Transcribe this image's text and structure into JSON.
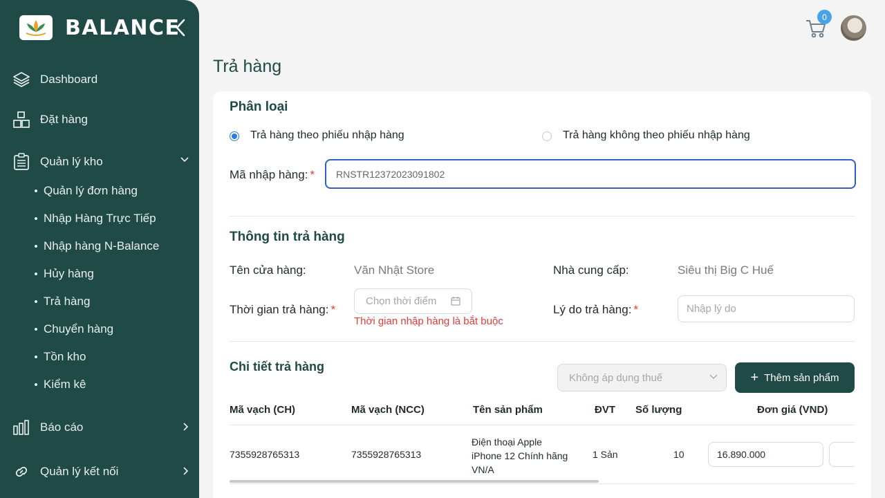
{
  "brand": {
    "name": "BALANCE",
    "logo_icon": "lotus-logo-icon"
  },
  "sidebar": {
    "items": [
      {
        "label": "Dashboard",
        "icon": "layers-icon"
      },
      {
        "label": "Đặt hàng",
        "icon": "boxes-icon"
      },
      {
        "label": "Quản lý kho",
        "icon": "clipboard-icon",
        "expanded": true
      },
      {
        "label": "Báo cáo",
        "icon": "bar-chart-icon"
      },
      {
        "label": "Quản lý kết nối",
        "icon": "link-icon"
      }
    ],
    "sub_items": [
      "Quản lý đơn hàng",
      "Nhập Hàng Trực Tiếp",
      "Nhập hàng N-Balance",
      "Hủy hàng",
      "Trả hàng",
      "Chuyển hàng",
      "Tồn kho",
      "Kiểm kê"
    ]
  },
  "header": {
    "cart_count": "0",
    "cart_icon": "cart-icon",
    "avatar": "user-avatar"
  },
  "page": {
    "title": "Trả hàng"
  },
  "classification": {
    "title": "Phân loại",
    "option_1": "Trả hàng theo phiếu nhập hàng",
    "option_2": "Trả hàng không theo phiếu nhập hàng",
    "selected": "option_1",
    "import_code_label": "Mã nhập hàng:",
    "import_code_value": "RNSTR12372023091802"
  },
  "return_info": {
    "title": "Thông tin trả hàng",
    "store_label": "Tên cửa hàng:",
    "store_value": "Văn Nhật Store",
    "supplier_label": "Nhà cung cấp:",
    "supplier_value": "Siêu thị Big C Huế",
    "time_label": "Thời gian trả hàng:",
    "time_placeholder": "Chọn thời điểm",
    "time_error": "Thời gian nhập hàng là bắt buộc",
    "reason_label": "Lý do trả hàng:",
    "reason_placeholder": "Nhập lý do"
  },
  "details": {
    "title": "Chi tiết trả hàng",
    "tax_select": "Không áp dụng thuế",
    "add_button": "Thêm sản phẩm",
    "columns": [
      "Mã vạch (CH)",
      "Mã vạch (NCC)",
      "Tên sản phẩm",
      "ĐVT",
      "Số lượng",
      "Đơn giá (VND)"
    ],
    "rows": [
      {
        "barcode_ch": "7355928765313",
        "barcode_ncc": "7355928765313",
        "name_line1": "Điện thoại Apple",
        "name_line2": "iPhone 12 Chính hãng",
        "name_line3": "VN/A",
        "unit": "1 Sản",
        "quantity": "10",
        "unit_price": "16.890.000"
      }
    ]
  },
  "colors": {
    "sidebar": "#1f4a45",
    "accent": "#2f7be0",
    "error": "#e23b3b",
    "badge": "#4aa3e8"
  }
}
